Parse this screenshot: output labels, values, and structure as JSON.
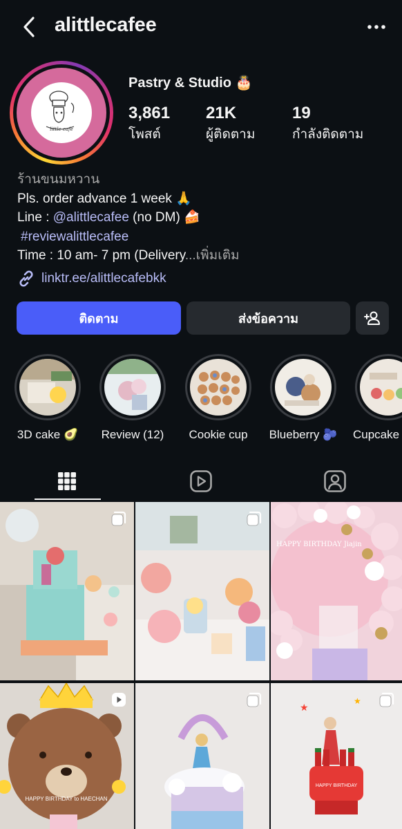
{
  "header": {
    "username": "alittlecafee",
    "back_icon": "chevron-left-icon",
    "more_icon": "more-horizontal-icon"
  },
  "profile": {
    "avatar_text": "little cafe",
    "full_name": "Pastry & Studio 🎂",
    "stats": [
      {
        "value": "3,861",
        "label": "โพสต์"
      },
      {
        "value": "21K",
        "label": "ผู้ติดตาม"
      },
      {
        "value": "19",
        "label": "กำลังติดตาม"
      }
    ]
  },
  "bio": {
    "category": "ร้านขนมหวาน",
    "line1": "Pls. order advance 1 week 🙏",
    "line2_prefix": "Line : ",
    "line2_mention": "@alittlecafee",
    "line2_suffix": " (no DM) 🍰",
    "hashtag": "#reviewalittlecafee",
    "line4": "Time : 10 am- 7 pm (Delivery",
    "more": "...เพิ่มเติม",
    "link": "linktr.ee/alittlecafebkk"
  },
  "actions": {
    "follow": "ติดตาม",
    "message": "ส่งข้อความ",
    "add_user_icon": "add-person-icon"
  },
  "highlights": [
    {
      "label": "3D cake 🥑"
    },
    {
      "label": "Review (12)"
    },
    {
      "label": "Cookie cup"
    },
    {
      "label": "Blueberry 🫐"
    },
    {
      "label": "Cupcake"
    }
  ],
  "tabs": [
    {
      "icon": "grid-icon",
      "active": true
    },
    {
      "icon": "reels-icon",
      "active": false
    },
    {
      "icon": "tagged-icon",
      "active": false
    }
  ],
  "posts": [
    {
      "badge": "carousel-icon",
      "image_text": ""
    },
    {
      "badge": "carousel-icon",
      "image_text": ""
    },
    {
      "badge": "",
      "image_text": "HAPPY BIRTHDAY Jiajin"
    },
    {
      "badge": "reel-icon",
      "image_text": "HAPPY BIRTHDAY to HAECHAN"
    },
    {
      "badge": "carousel-icon",
      "image_text": ""
    },
    {
      "badge": "carousel-icon",
      "image_text": "HAPPY BIRTHDAY"
    }
  ]
}
